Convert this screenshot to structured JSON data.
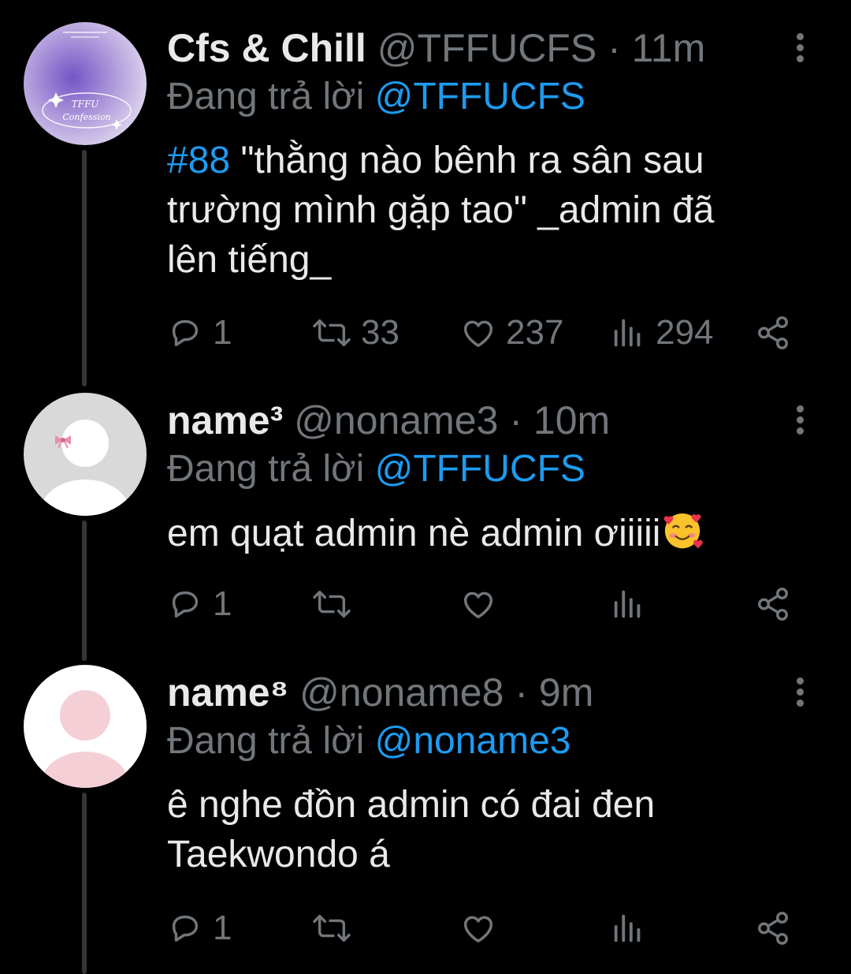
{
  "tweets": [
    {
      "display_name": "Cfs & Chill",
      "handle": "@TFFUCFS",
      "time": "11m",
      "reply_prefix": "Đang trả lời",
      "reply_to": "@TFFUCFS",
      "hashtag": "#88",
      "text_lines": [
        "\"thằng nào bênh ra sân sau",
        "trường mình gặp tao\" _admin đã",
        "lên tiếng_"
      ],
      "avatar_logo_text": [
        "TFFU",
        "Confession"
      ],
      "replies": "1",
      "retweets": "33",
      "likes": "237",
      "views": "294"
    },
    {
      "display_name": "name³",
      "handle": "@noname3",
      "time": "10m",
      "reply_prefix": "Đang trả lời",
      "reply_to": "@TFFUCFS",
      "text": "em quạt admin nè admin ơiiiii",
      "emoji": "smiling-face-with-hearts",
      "replies": "1",
      "retweets": "",
      "likes": "",
      "views": ""
    },
    {
      "display_name": "name⁸",
      "handle": "@noname8",
      "time": "9m",
      "reply_prefix": "Đang trả lời",
      "reply_to": "@noname3",
      "text_lines": [
        "ê nghe đồn admin có đai đen",
        "Taekwondo á"
      ],
      "replies": "1",
      "retweets": "",
      "likes": "",
      "views": ""
    }
  ],
  "separator": "·",
  "colors": {
    "background": "#000000",
    "text": "#e7e9ea",
    "secondary": "#71767b",
    "accent": "#1d9bf0",
    "thread_line": "#333639"
  },
  "icons": [
    "reply-icon",
    "retweet-icon",
    "like-icon",
    "views-icon",
    "share-icon",
    "more-icon"
  ]
}
